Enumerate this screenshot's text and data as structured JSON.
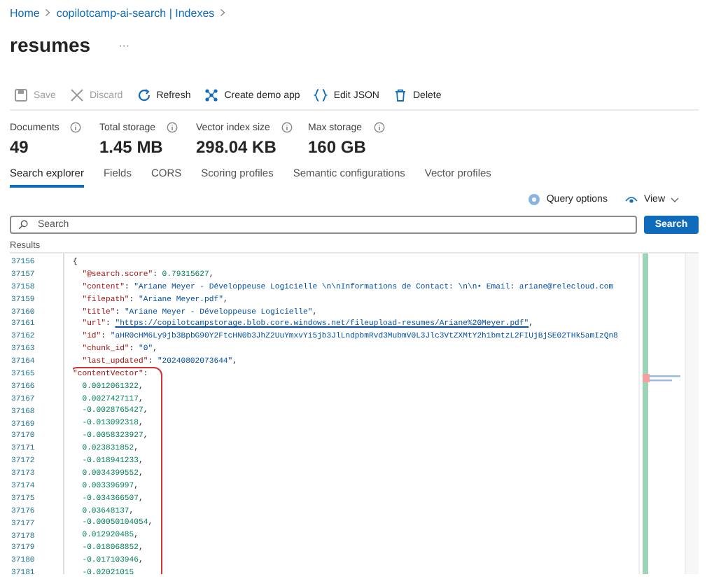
{
  "breadcrumb": [
    {
      "label": "Home"
    },
    {
      "label": "copilotcamp-ai-search | Indexes"
    }
  ],
  "title": "resumes",
  "more_button": "···",
  "toolbar": [
    {
      "kind": "save",
      "label": "Save",
      "disabled": true
    },
    {
      "kind": "discard",
      "label": "Discard",
      "disabled": true
    },
    {
      "kind": "refresh",
      "label": "Refresh",
      "disabled": false
    },
    {
      "kind": "demo",
      "label": "Create demo app",
      "disabled": false
    },
    {
      "kind": "json",
      "label": "Edit JSON",
      "disabled": false
    },
    {
      "kind": "delete",
      "label": "Delete",
      "disabled": false
    }
  ],
  "stats": [
    {
      "label": "Documents",
      "value": "49"
    },
    {
      "label": "Total storage",
      "value": "1.45 MB"
    },
    {
      "label": "Vector index size",
      "value": "298.04 KB"
    },
    {
      "label": "Max storage",
      "value": "160 GB"
    }
  ],
  "tabs": [
    {
      "label": "Search explorer",
      "selected": true
    },
    {
      "label": "Fields",
      "selected": false
    },
    {
      "label": "CORS",
      "selected": false
    },
    {
      "label": "Scoring profiles",
      "selected": false
    },
    {
      "label": "Semantic configurations",
      "selected": false
    },
    {
      "label": "Vector profiles",
      "selected": false
    }
  ],
  "query_options": "Query options",
  "view_button": "View",
  "search": {
    "placeholder": "Search",
    "button": "Search"
  },
  "results_label": "Results",
  "code_blocks": [
    {
      "highlighted": false,
      "lines": [
        {
          "number": "37156",
          "tokens": [
            {
              "kind": "punct",
              "text": "{"
            }
          ]
        },
        {
          "number": "37157",
          "tokens": [
            {
              "kind": "key",
              "text": "  \"@search.score\""
            },
            {
              "kind": "punct",
              "text": ": "
            },
            {
              "kind": "number",
              "text": "0.79315627"
            },
            {
              "kind": "punct",
              "text": ","
            }
          ]
        },
        {
          "number": "37158",
          "tokens": [
            {
              "kind": "key",
              "text": "  \"content\""
            },
            {
              "kind": "punct",
              "text": ": "
            },
            {
              "kind": "string",
              "text": "\"Ariane Meyer - Développeuse Logicielle \\n\\nInformations de Contact: \\n\\n• Email: ariane@relecloud.com"
            }
          ]
        },
        {
          "number": "37159",
          "tokens": [
            {
              "kind": "key",
              "text": "  \"filepath\""
            },
            {
              "kind": "punct",
              "text": ": "
            },
            {
              "kind": "string",
              "text": "\"Ariane Meyer.pdf\""
            },
            {
              "kind": "punct",
              "text": ","
            }
          ]
        },
        {
          "number": "37160",
          "tokens": [
            {
              "kind": "key",
              "text": "  \"title\""
            },
            {
              "kind": "punct",
              "text": ": "
            },
            {
              "kind": "string",
              "text": "\"Ariane Meyer - Développeuse Logicielle\""
            },
            {
              "kind": "punct",
              "text": ","
            }
          ]
        },
        {
          "number": "37161",
          "tokens": [
            {
              "kind": "key",
              "text": "  \"url\""
            },
            {
              "kind": "punct",
              "text": ": "
            },
            {
              "kind": "link",
              "text": "\"https://copilotcampstorage.blob.core.windows.net/fileupload-resumes/Ariane%20Meyer.pdf\""
            },
            {
              "kind": "punct",
              "text": ","
            }
          ]
        },
        {
          "number": "37162",
          "tokens": [
            {
              "kind": "key",
              "text": "  \"id\""
            },
            {
              "kind": "punct",
              "text": ": "
            },
            {
              "kind": "string",
              "text": "\"aHR0cHM6Ly9jb3BpbG90Y2FtcHN0b3JhZ2UuYmxvYi5jb3JlLndpbmRvd3MubmV0L3Jlc3VtZXMtY2h1bmtzL2FIUjBjSE02THk5amIzQn8"
            }
          ]
        },
        {
          "number": "37163",
          "tokens": [
            {
              "kind": "key",
              "text": "  \"chunk_id\""
            },
            {
              "kind": "punct",
              "text": ": "
            },
            {
              "kind": "string",
              "text": "\"0\""
            },
            {
              "kind": "punct",
              "text": ","
            }
          ]
        },
        {
          "number": "37164",
          "tokens": [
            {
              "kind": "key",
              "text": "  \"last_updated\""
            },
            {
              "kind": "punct",
              "text": ": "
            },
            {
              "kind": "string",
              "text": "\"20240802073644\""
            },
            {
              "kind": "punct",
              "text": ","
            }
          ]
        }
      ]
    },
    {
      "highlighted": true,
      "lines": [
        {
          "number": "37165",
          "tokens": [
            {
              "kind": "key",
              "text": "\"contentVector\""
            },
            {
              "kind": "punct",
              "text": ":"
            }
          ]
        },
        {
          "number": "37166",
          "tokens": [
            {
              "kind": "number",
              "text": "  0.0012061322"
            },
            {
              "kind": "punct",
              "text": ","
            }
          ]
        },
        {
          "number": "37167",
          "tokens": [
            {
              "kind": "number",
              "text": "  0.0027427117"
            },
            {
              "kind": "punct",
              "text": ","
            }
          ]
        },
        {
          "number": "37168",
          "tokens": [
            {
              "kind": "number",
              "text": "  -0.0028765427"
            },
            {
              "kind": "punct",
              "text": ","
            }
          ]
        },
        {
          "number": "37169",
          "tokens": [
            {
              "kind": "number",
              "text": "  -0.013092318"
            },
            {
              "kind": "punct",
              "text": ","
            }
          ]
        },
        {
          "number": "37170",
          "tokens": [
            {
              "kind": "number",
              "text": "  -0.0058323927"
            },
            {
              "kind": "punct",
              "text": ","
            }
          ]
        },
        {
          "number": "37171",
          "tokens": [
            {
              "kind": "number",
              "text": "  0.023831852"
            },
            {
              "kind": "punct",
              "text": ","
            }
          ]
        },
        {
          "number": "37172",
          "tokens": [
            {
              "kind": "number",
              "text": "  -0.018941233"
            },
            {
              "kind": "punct",
              "text": ","
            }
          ]
        },
        {
          "number": "37173",
          "tokens": [
            {
              "kind": "number",
              "text": "  0.0034399552"
            },
            {
              "kind": "punct",
              "text": ","
            }
          ]
        },
        {
          "number": "37174",
          "tokens": [
            {
              "kind": "number",
              "text": "  0.003396997"
            },
            {
              "kind": "punct",
              "text": ","
            }
          ]
        },
        {
          "number": "37175",
          "tokens": [
            {
              "kind": "number",
              "text": "  -0.034366507"
            },
            {
              "kind": "punct",
              "text": ","
            }
          ]
        },
        {
          "number": "37176",
          "tokens": [
            {
              "kind": "number",
              "text": "  0.03648137"
            },
            {
              "kind": "punct",
              "text": ","
            }
          ]
        },
        {
          "number": "37177",
          "tokens": [
            {
              "kind": "number",
              "text": "  -0.00050104054"
            },
            {
              "kind": "punct",
              "text": ","
            }
          ]
        },
        {
          "number": "37178",
          "tokens": [
            {
              "kind": "number",
              "text": "  0.012920485"
            },
            {
              "kind": "punct",
              "text": ","
            }
          ]
        },
        {
          "number": "37179",
          "tokens": [
            {
              "kind": "number",
              "text": "  -0.018068852"
            },
            {
              "kind": "punct",
              "text": ","
            }
          ]
        },
        {
          "number": "37180",
          "tokens": [
            {
              "kind": "number",
              "text": "  -0.017103946"
            },
            {
              "kind": "punct",
              "text": ","
            }
          ]
        },
        {
          "number": "37181",
          "tokens": [
            {
              "kind": "number",
              "text": "  -0.02021015"
            }
          ]
        }
      ]
    }
  ]
}
